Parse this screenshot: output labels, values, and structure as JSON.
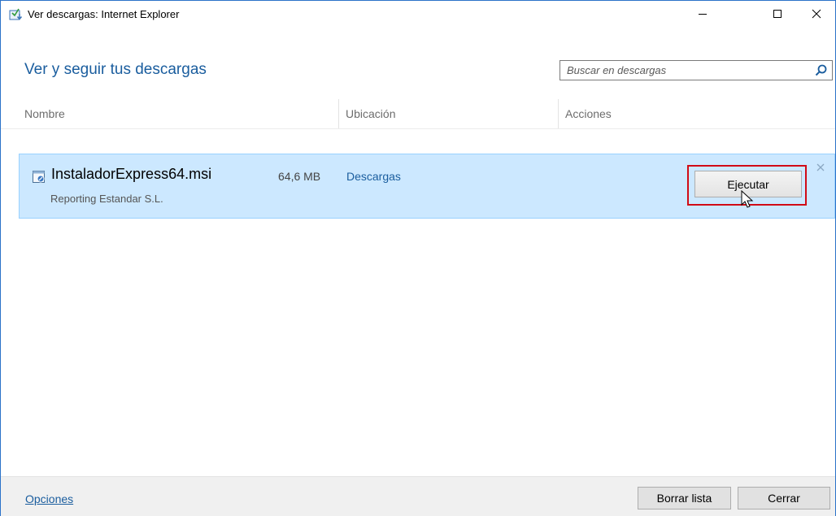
{
  "window": {
    "title": "Ver descargas: Internet Explorer"
  },
  "header": {
    "title": "Ver y seguir tus descargas"
  },
  "search": {
    "placeholder": "Buscar en descargas",
    "value": ""
  },
  "columns": {
    "name": "Nombre",
    "location": "Ubicación",
    "actions": "Acciones"
  },
  "downloads": [
    {
      "file_name": "InstaladorExpress64.msi",
      "size": "64,6 MB",
      "location": "Descargas",
      "publisher": "Reporting Estandar S.L.",
      "action_label": "Ejecutar"
    }
  ],
  "footer": {
    "options_label": "Opciones",
    "clear_list_label": "Borrar lista",
    "close_label": "Cerrar"
  },
  "colors": {
    "accent": "#1a5d9e",
    "row_selected": "#cce8ff",
    "highlight_border": "#d10a16"
  }
}
